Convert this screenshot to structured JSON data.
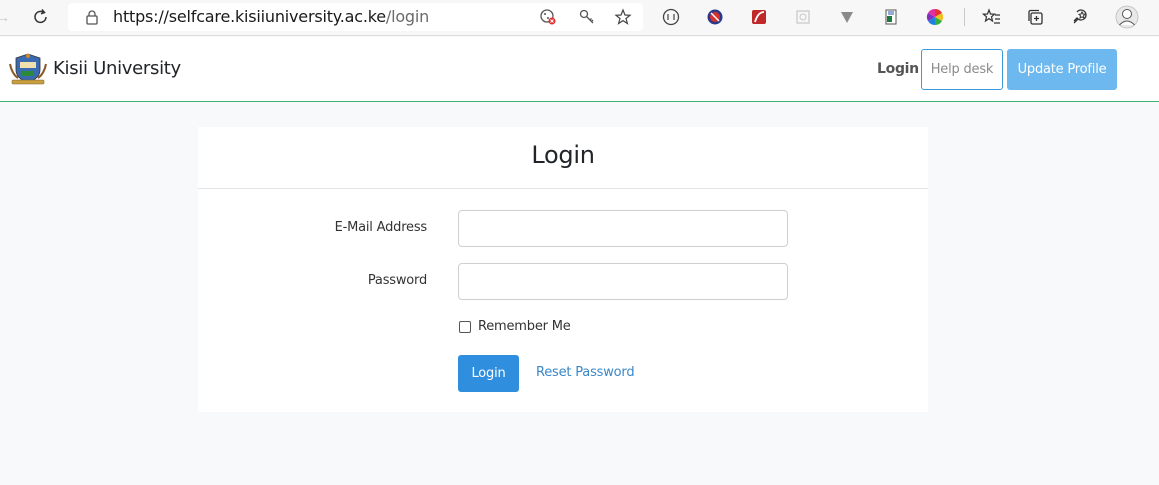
{
  "browser": {
    "url_host": "https://selfcare.kisiiuniversity.ac.ke",
    "url_path": "/login",
    "icons": [
      "back-icon",
      "reload-icon",
      "lock-icon",
      "cookie-blocked-icon",
      "key-icon",
      "favorite-star-icon",
      "reader-icon",
      "extension-red-icon",
      "extension-flash-icon",
      "extension-grid-icon",
      "extension-triangle-icon",
      "extension-sheet-icon",
      "extension-color-wheel-icon",
      "favorites-list-icon",
      "collections-icon",
      "feedback-icon",
      "profile-avatar-icon"
    ]
  },
  "navbar": {
    "brand": "Kisii University",
    "login_link": "Login",
    "help_button": "Help desk",
    "update_button": "Update Profile",
    "accent_color": "#3cb371"
  },
  "card": {
    "title": "Login",
    "email_label": "E-Mail Address",
    "password_label": "Password",
    "remember_label": "Remember Me",
    "login_button": "Login",
    "reset_link": "Reset Password",
    "button_color": "#2f8fde"
  }
}
